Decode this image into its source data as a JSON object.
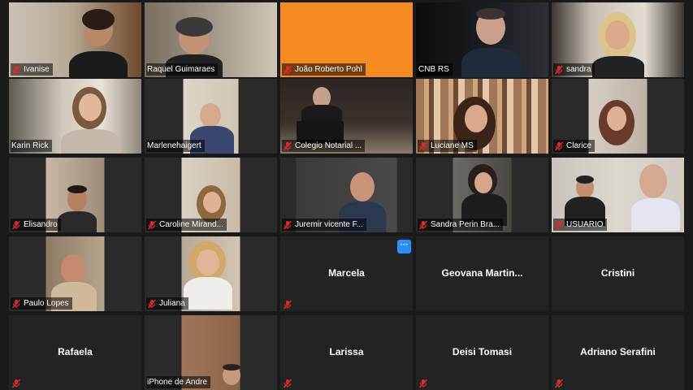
{
  "participants": [
    {
      "name": "Ivanise",
      "has_video": true,
      "muted": true
    },
    {
      "name": "Raquel Guimaraes",
      "has_video": true,
      "muted": false
    },
    {
      "name": "João Roberto Pohl",
      "has_video": true,
      "muted": true
    },
    {
      "name": "CNB RS",
      "has_video": true,
      "muted": false
    },
    {
      "name": "sandra",
      "has_video": true,
      "muted": true
    },
    {
      "name": "Karin Rick",
      "has_video": true,
      "muted": false
    },
    {
      "name": "Marlenehaigert",
      "has_video": true,
      "muted": false,
      "active_speaker": true
    },
    {
      "name": "Colegio Notarial ...",
      "has_video": true,
      "muted": true
    },
    {
      "name": "Luciane MS",
      "has_video": true,
      "muted": true
    },
    {
      "name": "Clarice",
      "has_video": true,
      "muted": true
    },
    {
      "name": "Elisandro",
      "has_video": true,
      "muted": true
    },
    {
      "name": "Caroline Mirand...",
      "has_video": true,
      "muted": true
    },
    {
      "name": "Juremir vicente F...",
      "has_video": true,
      "muted": true
    },
    {
      "name": "Sandra Perin Bra...",
      "has_video": true,
      "muted": true
    },
    {
      "name": "USUARIO",
      "has_video": true,
      "muted": true
    },
    {
      "name": "Paulo Lopes",
      "has_video": true,
      "muted": true
    },
    {
      "name": "Juliana",
      "has_video": true,
      "muted": true
    },
    {
      "name": "Marcela",
      "has_video": false,
      "muted": true
    },
    {
      "name": "Geovana  Martin...",
      "has_video": false,
      "muted": false
    },
    {
      "name": "Cristini",
      "has_video": false,
      "muted": false
    },
    {
      "name": "Rafaela",
      "has_video": false,
      "muted": true
    },
    {
      "name": "iPhone de Andre",
      "has_video": true,
      "muted": false
    },
    {
      "name": "Larissa",
      "has_video": false,
      "muted": true
    },
    {
      "name": "Deisi Tomasi",
      "has_video": false,
      "muted": true
    },
    {
      "name": "Adriano Serafini",
      "has_video": false,
      "muted": true
    }
  ],
  "more_button": {
    "label": "···"
  },
  "colors": {
    "mute_red": "#e02828",
    "active_border": "#e3f294",
    "accent_blue": "#2d8cff"
  }
}
